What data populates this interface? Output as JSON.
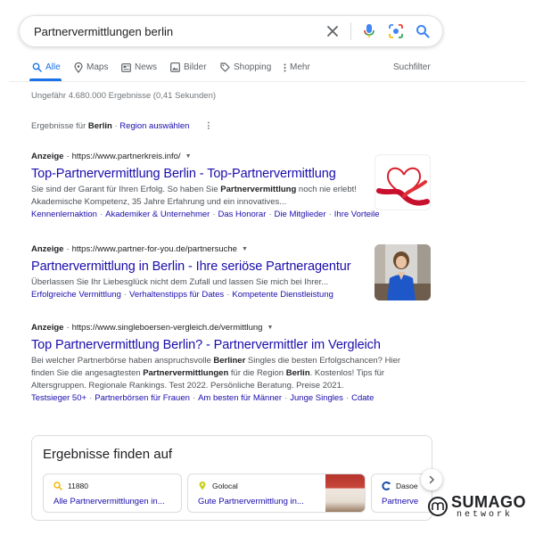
{
  "search": {
    "query": "Partnervermittlungen berlin"
  },
  "tabs": [
    {
      "label": "Alle",
      "icon": "search-icon"
    },
    {
      "label": "Maps",
      "icon": "map-pin-icon"
    },
    {
      "label": "News",
      "icon": "news-icon"
    },
    {
      "label": "Bilder",
      "icon": "image-icon"
    },
    {
      "label": "Shopping",
      "icon": "tag-icon"
    },
    {
      "label": "Mehr",
      "icon": "more-vert-icon"
    }
  ],
  "tools_label": "Suchfilter",
  "result_stats": "Ungefähr 4.680.000 Ergebnisse (0,41 Sekunden)",
  "region": {
    "prefix": "Ergebnisse für",
    "location": "Berlin",
    "separator": "·",
    "link": "Region auswählen"
  },
  "ads": [
    {
      "badge": "Anzeige",
      "dot": "·",
      "url": "https://www.partnerkreis.info/",
      "title": "Top-Partnervermittlung Berlin - Top-Partnervermittlung",
      "desc": [
        {
          "t": "Sie sind der Garant für Ihren Erfolg. So haben Sie ",
          "b": false
        },
        {
          "t": "Partnervermittlung",
          "b": true
        },
        {
          "t": " noch nie erlebt! Akademische Kompetenz, 35 Jahre Erfahrung und ein innovatives...",
          "b": false
        }
      ],
      "sitelinks": [
        "Kennenlernaktion",
        "Akademiker & Unternehmer",
        "Das Honorar",
        "Die Mitglieder",
        "Ihre Vorteile"
      ]
    },
    {
      "badge": "Anzeige",
      "dot": "·",
      "url": "https://www.partner-for-you.de/partnersuche",
      "title": "Partnervermittlung in Berlin - Ihre seriöse Partneragentur",
      "desc": [
        {
          "t": "Überlassen Sie Ihr Liebesglück nicht dem Zufall und lassen Sie mich bei Ihrer...",
          "b": false
        }
      ],
      "sitelinks": [
        "Erfolgreiche Vermittlung",
        "Verhaltenstipps für Dates",
        "Kompetente Dienstleistung"
      ]
    },
    {
      "badge": "Anzeige",
      "dot": "·",
      "url": "https://www.singleboersen-vergleich.de/vermittlung",
      "title": "Top Partnervermittlung Berlin? - Partnervermittler im Vergleich",
      "desc": [
        {
          "t": "Bei welcher Partnerbörse haben anspruchsvolle ",
          "b": false
        },
        {
          "t": "Berliner",
          "b": true
        },
        {
          "t": " Singles die besten Erfolgschancen? Hier finden Sie die angesagtesten ",
          "b": false
        },
        {
          "t": "Partnervermittlungen",
          "b": true
        },
        {
          "t": " für die Region ",
          "b": false
        },
        {
          "t": "Berlin",
          "b": true
        },
        {
          "t": ". Kostenlos! Tips für Altersgruppen. Regionale Rankings. Test 2022. Persönliche Beratung. Preise 2021.",
          "b": false
        }
      ],
      "sitelinks": [
        "Testsieger 50+",
        "Partnerbörsen für Frauen",
        "Am besten für Männer",
        "Junge Singles",
        "Cdate"
      ]
    }
  ],
  "finder": {
    "title": "Ergebnisse finden auf",
    "cards": [
      {
        "site": "11880",
        "icon": "search-icon",
        "link": "Alle Partnervermittlungen in..."
      },
      {
        "site": "Golocal",
        "icon": "location-pin-icon",
        "link": "Gute Partnervermittlung in..."
      },
      {
        "site": "Dasoe",
        "icon": "dasoertliche-logo-icon",
        "link": "Partnerve"
      }
    ]
  },
  "brand": {
    "name": "SUMAGO",
    "sub": "network"
  },
  "colors": {
    "link": "#1a0dab",
    "accent": "#1a73e8",
    "muted": "#70757a",
    "text": "#4d5156"
  }
}
